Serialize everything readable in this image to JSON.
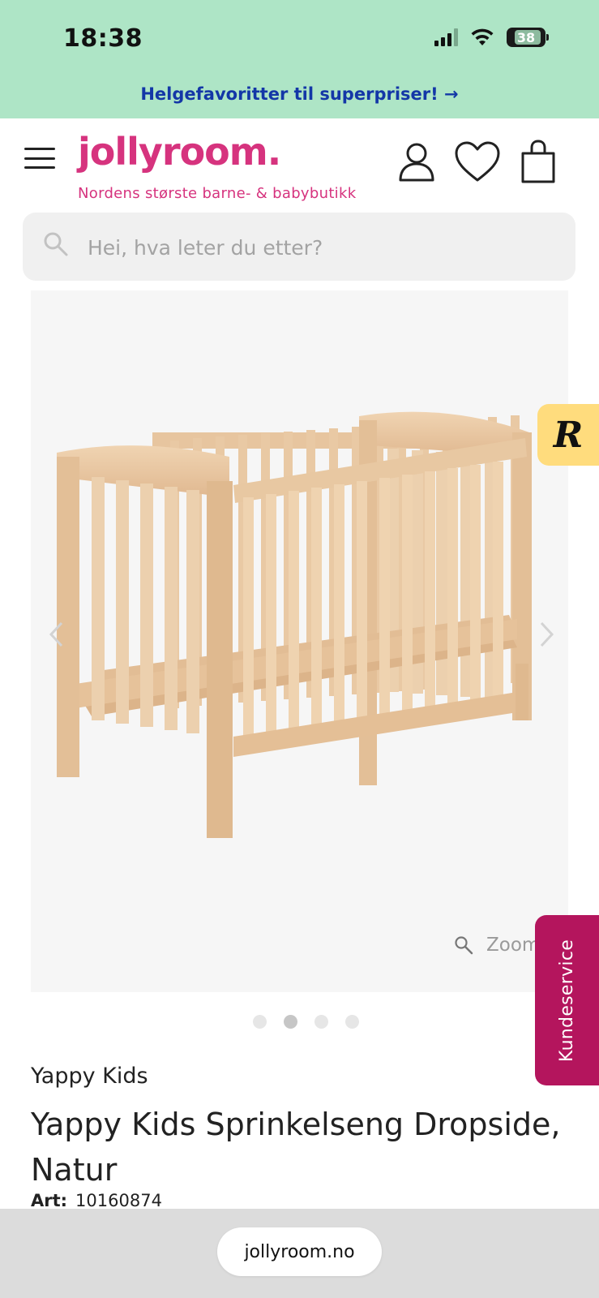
{
  "status_bar": {
    "time": "18:38",
    "battery_level": "38",
    "icons": [
      "cellular-signal-icon",
      "wifi-icon",
      "battery-icon"
    ]
  },
  "promo_banner": {
    "text": "Helgefavoritter til superpriser! →"
  },
  "header": {
    "logo_text": "jollyroom.",
    "tagline": "Nordens største barne- & babybutikk",
    "icons": [
      "hamburger-menu-icon",
      "account-icon",
      "favorites-heart-icon",
      "shopping-bag-icon"
    ]
  },
  "search": {
    "placeholder": "Hei, hva leter du etter?",
    "value": ""
  },
  "gallery": {
    "zoom_label": "Zoom",
    "slide_count": 4,
    "active_slide": 2,
    "image_description_icon": "wooden-crib-image"
  },
  "side_tabs": {
    "rewards_letter": "R",
    "support_label": "Kundeservice"
  },
  "product": {
    "brand": "Yappy Kids",
    "title": "Yappy Kids Sprinkelseng Dropside, Natur",
    "art_label": "Art:",
    "art_number": "10160874"
  },
  "browser": {
    "url": "jollyroom.no"
  },
  "colors": {
    "top_band": "#aee5c6",
    "promo_text": "#1337a7",
    "brand_pink": "#d6337e",
    "support_tab": "#b4155d",
    "rewards_tab": "#ffdc7d"
  }
}
